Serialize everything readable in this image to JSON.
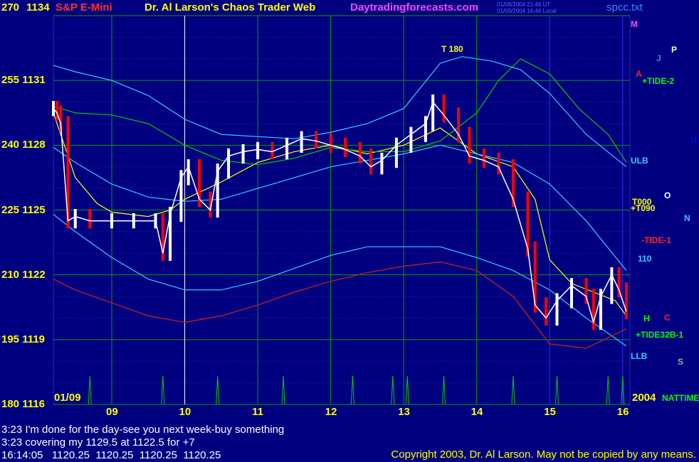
{
  "colors": {
    "background": "#000080",
    "price_up": "#ffffff",
    "price_down": "#ff0000",
    "avg_yellow": "#ffff00",
    "avg_green": "#00cc00",
    "avg_cyan": "#33ccff",
    "avg_red": "#cc2222",
    "grid_green": "#00a000",
    "grid_blue": "#3030ff"
  },
  "header": {
    "left_y1": "270",
    "left_y2": "1134",
    "symbol": "S&P E-Mini",
    "title": "Dr. Al Larson's Chaos Trader Web",
    "site": "Daytradingforecasts.com",
    "timestamp1": "01/09/2004 21:46 UT",
    "timestamp2": "01/09/2004 16:46 Local",
    "file": "spcc.txt"
  },
  "messages": {
    "line1": "3:23 I'm done for the day-see you next week-buy something",
    "line2": "3:23 covering my 1129.5 at 1122.5 for +7",
    "quote_time": "16:14:05",
    "quote_open": "1120.25",
    "quote_high": "1120.25",
    "quote_low": "1120.25",
    "quote_close": "1120.25",
    "copyright": "Copyright 2003, Dr. Al Larson. May not be copied by any means."
  },
  "chart_data": {
    "type": "line",
    "title": "S&P E-Mini",
    "xlabel": "",
    "ylabel": "",
    "x_ticks": [
      "09",
      "10",
      "11",
      "12",
      "13",
      "14",
      "15",
      "16"
    ],
    "start_label": "01/09",
    "end_label": "2004",
    "ylim": [
      1116,
      1134
    ],
    "y_ticks": [
      {
        "angle": "180",
        "price": "1116"
      },
      {
        "angle": "195",
        "price": "1119"
      },
      {
        "angle": "210",
        "price": "1122"
      },
      {
        "angle": "225",
        "price": "1125"
      },
      {
        "angle": "240",
        "price": "1128"
      },
      {
        "angle": "255",
        "price": "1131"
      },
      {
        "angle": "270",
        "price": "1134"
      }
    ],
    "grid": true,
    "series": [
      {
        "name": "price",
        "x": [
          8.2,
          8.25,
          8.3,
          8.4,
          8.5,
          8.7,
          9.0,
          9.3,
          9.6,
          9.7,
          9.8,
          9.95,
          10.05,
          10.2,
          10.35,
          10.45,
          10.6,
          10.8,
          11.0,
          11.2,
          11.4,
          11.6,
          11.8,
          12.0,
          12.2,
          12.4,
          12.55,
          12.7,
          12.9,
          13.1,
          13.3,
          13.4,
          13.55,
          13.75,
          13.9,
          14.1,
          14.3,
          14.5,
          14.7,
          14.8,
          14.95,
          15.1,
          15.3,
          15.5,
          15.6,
          15.7,
          15.85,
          15.95,
          16.05
        ],
        "y": [
          1129.7,
          1129.5,
          1129.0,
          1124.5,
          1124.7,
          1124.5,
          1124.5,
          1124.5,
          1124.5,
          1123.0,
          1124.8,
          1126.5,
          1127.0,
          1125.5,
          1125.0,
          1126.8,
          1127.5,
          1127.7,
          1127.8,
          1127.7,
          1128.0,
          1128.3,
          1128.2,
          1128.0,
          1127.8,
          1127.5,
          1127.0,
          1127.3,
          1128.0,
          1128.5,
          1129.0,
          1130.0,
          1129.4,
          1128.5,
          1127.5,
          1127.3,
          1127.0,
          1125.5,
          1123.2,
          1120.6,
          1120.0,
          1120.8,
          1121.5,
          1121.0,
          1119.8,
          1121.0,
          1122.0,
          1121.3,
          1120.3
        ]
      },
      {
        "name": "ma-yellow",
        "x": [
          8.2,
          8.3,
          8.5,
          8.8,
          9.0,
          9.5,
          9.8,
          10.0,
          10.5,
          11.0,
          11.5,
          12.0,
          12.5,
          13.0,
          13.5,
          14.0,
          14.5,
          14.8,
          15.0,
          15.3,
          15.6,
          15.9,
          16.05
        ],
        "y": [
          1129.5,
          1128.5,
          1126.5,
          1125.3,
          1124.9,
          1124.7,
          1125.0,
          1125.5,
          1126.3,
          1127.2,
          1127.7,
          1128.0,
          1127.6,
          1128.0,
          1128.8,
          1127.6,
          1127.0,
          1125.5,
          1122.7,
          1121.6,
          1121.2,
          1120.8,
          1120.1
        ]
      },
      {
        "name": "ma-green",
        "x": [
          8.2,
          8.5,
          9.0,
          9.5,
          10.0,
          10.5,
          11.0,
          11.5,
          12.0,
          12.5,
          13.0,
          13.5,
          14.0,
          14.3,
          14.6,
          15.0,
          15.4,
          15.8,
          16.05
        ],
        "y": [
          1129.8,
          1129.5,
          1129.4,
          1129.0,
          1128.0,
          1127.3,
          1127.1,
          1127.4,
          1127.9,
          1127.7,
          1127.7,
          1128.2,
          1129.5,
          1131.0,
          1132.0,
          1131.3,
          1129.7,
          1128.5,
          1127.2
        ]
      },
      {
        "name": "ma-cyan-upper",
        "x": [
          8.2,
          8.5,
          9.0,
          9.5,
          10.0,
          10.5,
          11.0,
          11.5,
          12.0,
          12.5,
          13.0,
          13.5,
          13.8,
          14.2,
          14.6,
          15.0,
          15.5,
          16.05
        ],
        "y": [
          1131.7,
          1131.4,
          1131.0,
          1130.3,
          1129.2,
          1128.5,
          1128.4,
          1128.3,
          1128.6,
          1129.0,
          1129.7,
          1131.8,
          1132.1,
          1131.9,
          1131.5,
          1130.4,
          1128.5,
          1127.0
        ]
      },
      {
        "name": "ma-cyan-mid",
        "x": [
          8.2,
          8.5,
          9.0,
          9.5,
          10.0,
          10.5,
          11.0,
          11.5,
          12.0,
          12.5,
          13.0,
          13.5,
          14.0,
          14.5,
          15.0,
          15.5,
          16.05
        ],
        "y": [
          1127.9,
          1127.2,
          1126.2,
          1125.6,
          1125.4,
          1125.5,
          1126.0,
          1126.5,
          1127.0,
          1127.3,
          1127.6,
          1128.0,
          1127.6,
          1127.2,
          1126.2,
          1124.5,
          1122.2
        ]
      },
      {
        "name": "ma-cyan-lower",
        "x": [
          8.2,
          8.5,
          9.0,
          9.5,
          10.0,
          10.5,
          11.0,
          11.5,
          12.0,
          12.5,
          13.0,
          13.5,
          14.0,
          14.5,
          15.0,
          15.5,
          16.05
        ],
        "y": [
          1124.8,
          1124.0,
          1122.8,
          1121.8,
          1121.3,
          1121.3,
          1121.7,
          1122.3,
          1122.9,
          1123.3,
          1123.3,
          1123.3,
          1122.8,
          1122.2,
          1121.3,
          1120.0,
          1118.7
        ]
      },
      {
        "name": "ma-red",
        "x": [
          8.2,
          8.5,
          9.0,
          9.5,
          10.0,
          10.5,
          11.0,
          11.5,
          12.0,
          12.5,
          13.0,
          13.5,
          14.0,
          14.5,
          15.0,
          15.5,
          16.05
        ],
        "y": [
          1121.8,
          1121.3,
          1120.7,
          1120.1,
          1119.8,
          1120.1,
          1120.6,
          1121.2,
          1121.7,
          1122.1,
          1122.4,
          1122.6,
          1122.2,
          1121.0,
          1118.8,
          1118.6,
          1119.5
        ]
      }
    ],
    "annotations": [
      "T 180",
      "M",
      "J",
      "P",
      "A",
      "+TIDE-2",
      "U",
      "ULB",
      "T000",
      "+T090",
      "O",
      "N",
      "-TIDE-1",
      "110",
      "H",
      "C",
      "+TIDE32B-1",
      "LLB",
      "S",
      "NATTIME"
    ]
  }
}
